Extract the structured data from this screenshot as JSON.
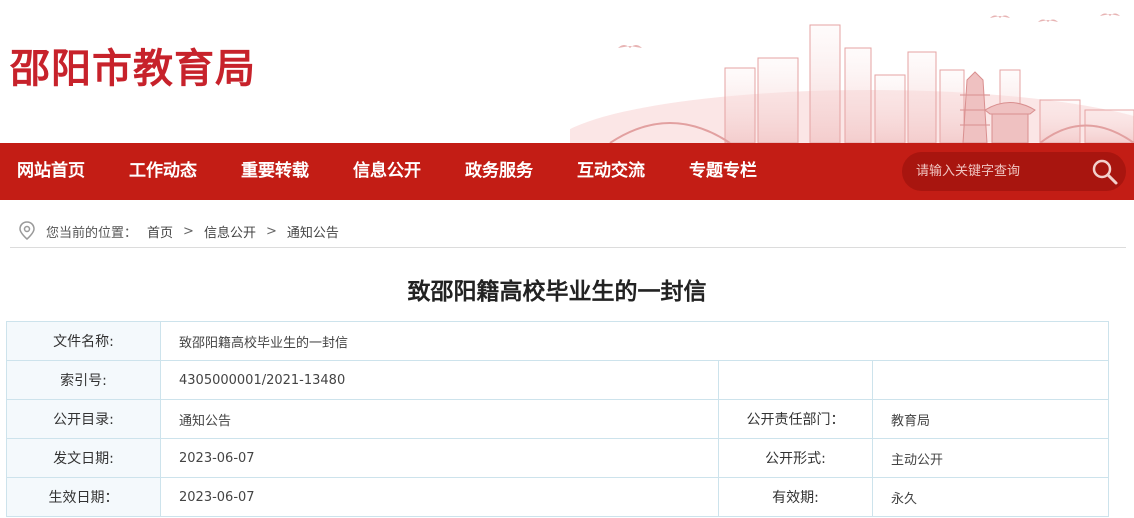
{
  "header": {
    "site_title": "邵阳市教育局"
  },
  "nav": {
    "items": [
      "网站首页",
      "工作动态",
      "重要转载",
      "信息公开",
      "政务服务",
      "互动交流",
      "专题专栏"
    ],
    "search_placeholder": "请输入关键字查询"
  },
  "breadcrumb": {
    "prefix": "您当前的位置：",
    "items": [
      "首页",
      "信息公开",
      "通知公告"
    ],
    "separator": ">"
  },
  "article": {
    "title": "致邵阳籍高校毕业生的一封信"
  },
  "info_table": {
    "file_name_label": "文件名称:",
    "file_name_value": "致邵阳籍高校毕业生的一封信",
    "index_label": "索引号:",
    "index_value": "4305000001/2021-13480",
    "catalog_label": "公开目录:",
    "catalog_value": "通知公告",
    "dept_label": "公开责任部门：",
    "dept_value": "教育局",
    "issue_date_label": "发文日期:",
    "issue_date_value": "2023-06-07",
    "form_label": "公开形式:",
    "form_value": "主动公开",
    "effective_label": "生效日期：",
    "effective_value": "2023-06-07",
    "validity_label": "有效期:",
    "validity_value": "永久"
  },
  "colors": {
    "brand_red": "#c31d15",
    "title_red": "#c7222b",
    "table_border": "#cde3ec",
    "label_bg": "#f4f9fc"
  }
}
